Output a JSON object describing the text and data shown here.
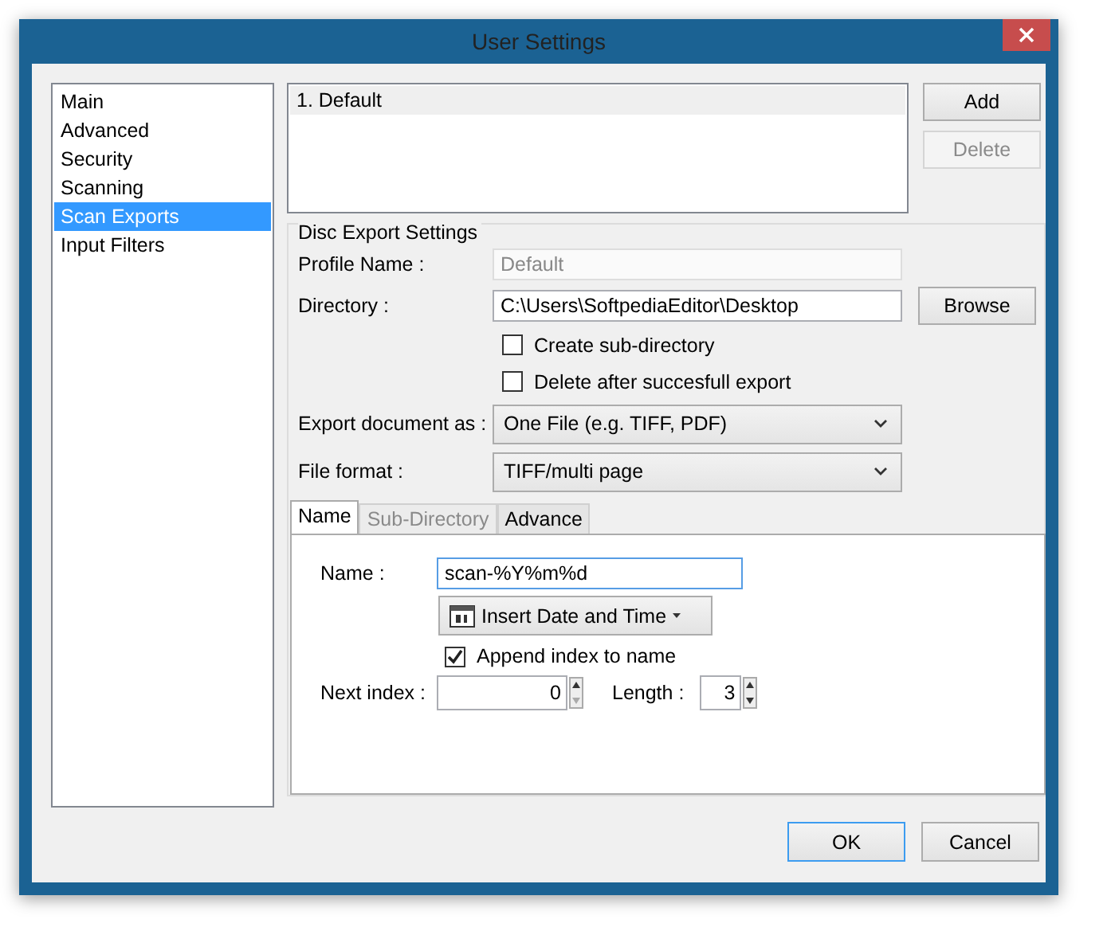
{
  "window": {
    "title": "User Settings"
  },
  "sidebar": {
    "items": [
      {
        "label": "Main",
        "selected": false
      },
      {
        "label": "Advanced",
        "selected": false
      },
      {
        "label": "Security",
        "selected": false
      },
      {
        "label": "Scanning",
        "selected": false
      },
      {
        "label": "Scan Exports",
        "selected": true
      },
      {
        "label": "Input Filters",
        "selected": false
      }
    ]
  },
  "profiles": [
    {
      "label": "1. Default",
      "selected": true
    }
  ],
  "profile_buttons": [
    {
      "label": "Add",
      "disabled": false
    },
    {
      "label": "Delete",
      "disabled": true
    }
  ],
  "disc_export": {
    "legend": "Disc Export Settings",
    "rows": [
      {
        "kind": "text",
        "label": "Profile Name :",
        "value": "Default",
        "disabled": true
      },
      {
        "kind": "text",
        "label": "Directory :",
        "value": "C:\\Users\\SoftpediaEditor\\Desktop",
        "disabled": false,
        "button": "Browse"
      },
      {
        "kind": "checkbox",
        "label": "Create sub-directory",
        "checked": false
      },
      {
        "kind": "checkbox",
        "label": "Delete after succesfull export",
        "checked": false
      },
      {
        "kind": "select",
        "label": "Export document as :",
        "value": "One File (e.g. TIFF, PDF)"
      },
      {
        "kind": "select",
        "label": "File format :",
        "value": "TIFF/multi page"
      }
    ]
  },
  "tabs": [
    {
      "label": "Name",
      "selected": true,
      "disabled": false
    },
    {
      "label": "Sub-Directory",
      "selected": false,
      "disabled": true
    },
    {
      "label": "Advance",
      "selected": false,
      "disabled": false
    }
  ],
  "name_tab": {
    "name": {
      "label": "Name :",
      "value": "scan-%Y%m%d"
    },
    "insert_button": {
      "label": "Insert Date and Time"
    },
    "append": {
      "label": "Append index to name",
      "checked": true
    },
    "next_index": {
      "label": "Next index :",
      "value": "0"
    },
    "length": {
      "label": "Length :",
      "value": "3"
    }
  },
  "footer_buttons": [
    {
      "label": "OK",
      "default": true
    },
    {
      "label": "Cancel",
      "default": false
    }
  ]
}
